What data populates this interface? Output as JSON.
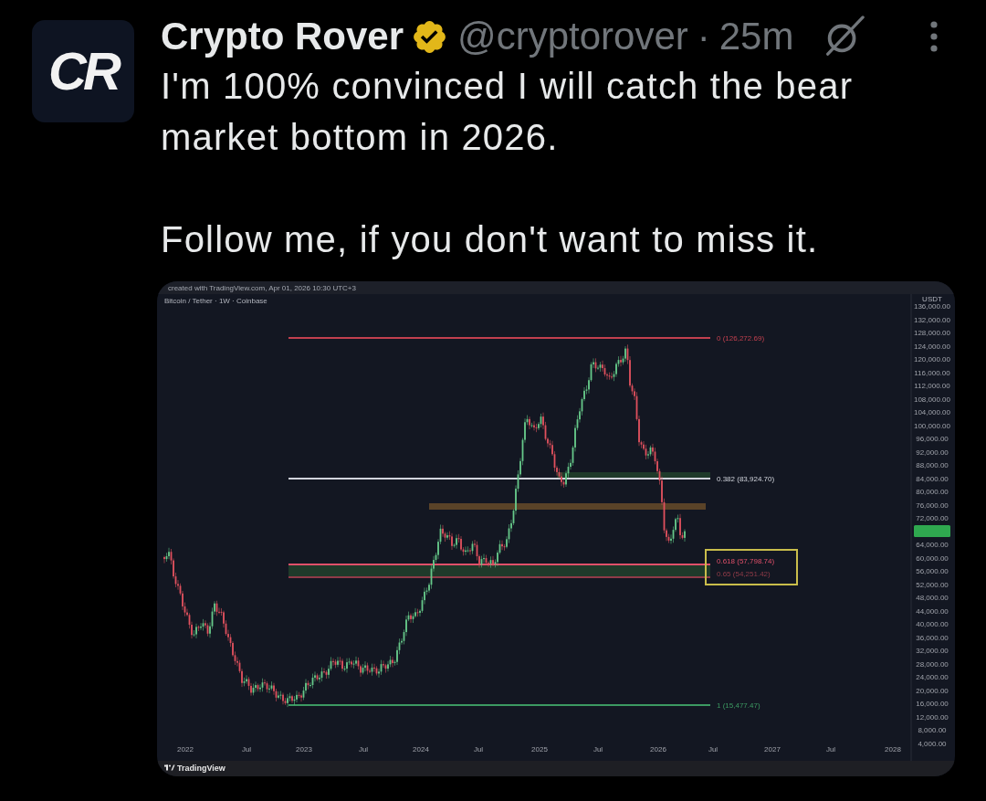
{
  "tweet": {
    "avatar": {
      "text": "CR"
    },
    "author": {
      "name": "Crypto Rover",
      "verified": true,
      "handle": "@cryptorover",
      "separator": "·",
      "time": "25m"
    },
    "paragraphs": [
      "I'm 100% convinced I will catch the bear market bottom in 2026.",
      "Follow me, if you don't want to miss it."
    ],
    "media": {
      "chart": {
        "watermark": "created with TradingView.com, Apr 01, 2026 10:30 UTC+3",
        "symbol": "Bitcoin / Tether · 1W · Coinbase",
        "unit": "USDT",
        "price_labels": [
          "136,000.00",
          "132,000.00",
          "128,000.00",
          "124,000.00",
          "120,000.00",
          "116,000.00",
          "112,000.00",
          "108,000.00",
          "104,000.00",
          "100,000.00",
          "96,000.00",
          "92,000.00",
          "88,000.00",
          "84,000.00",
          "80,000.00",
          "76,000.00",
          "72,000.00",
          "64,000.00",
          "60,000.00",
          "56,000.00",
          "52,000.00",
          "48,000.00",
          "44,000.00",
          "40,000.00",
          "36,000.00",
          "32,000.00",
          "28,000.00",
          "24,000.00",
          "20,000.00",
          "16,000.00",
          "12,000.00",
          "8,000.00",
          "4,000.00"
        ],
        "time_labels": [
          "2022",
          "Jul",
          "2023",
          "Jul",
          "2024",
          "Jul",
          "2025",
          "Jul",
          "2026",
          "Jul",
          "2027",
          "Jul",
          "2028"
        ],
        "levels": [
          {
            "label": "0 (126,272.69)",
            "color": "#c2404f"
          },
          {
            "label": "0.382 (83,924.70)",
            "color": "#d1d4dc"
          },
          {
            "label": "0.618 (57,798.74)",
            "color": "#e0506a"
          },
          {
            "label": "0.65 (54,251.42)",
            "color": "#8f3b48"
          },
          {
            "label": "1 (15,477.47)",
            "color": "#3c9a62"
          }
        ],
        "brand": "TradingView"
      }
    }
  }
}
